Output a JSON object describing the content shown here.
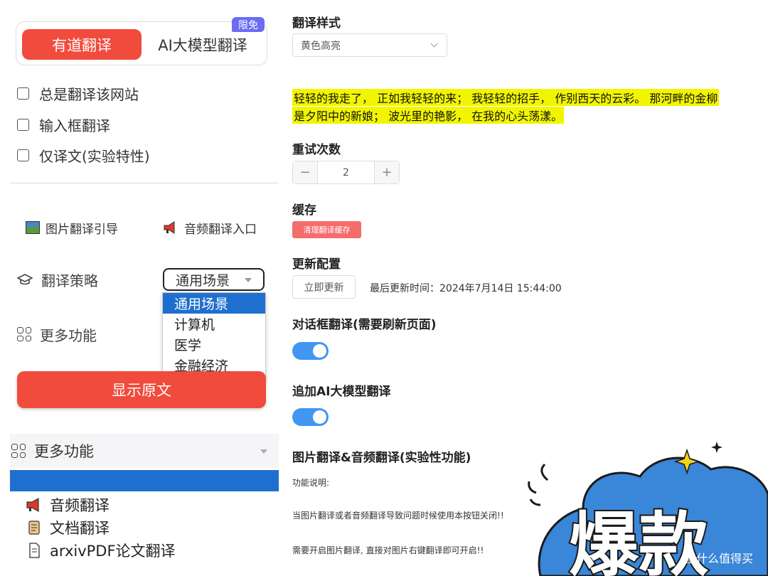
{
  "left": {
    "tabs": {
      "active": "有道翻译",
      "ai": "AI大模型翻译",
      "badge": "限免"
    },
    "checkboxes": [
      "总是翻译该网站",
      "输入框翻译",
      "仅译文(实验特性)"
    ],
    "links": {
      "image_guide": "图片翻译引导",
      "audio_entry": "音频翻译入口"
    },
    "strategy": {
      "label": "翻译策略",
      "selected": "通用场景",
      "options": [
        "通用场景",
        "计算机",
        "医学",
        "金融经济"
      ]
    },
    "more_features": "更多功能",
    "show_original": "显示原文",
    "more_bar": "更多功能",
    "list": [
      "音频翻译",
      "文档翻译",
      "arxivPDF论文翻译"
    ]
  },
  "right": {
    "style_title": "翻译样式",
    "style_selected": "黄色高亮",
    "sample_line1": "轻轻的我走了， 正如我轻轻的来； 我轻轻的招手， 作别西天的云彩。 那河畔的金柳",
    "sample_line2": "是夕阳中的新娘； 波光里的艳影， 在我的心头荡漾。",
    "retry_title": "重试次数",
    "retry_value": "2",
    "cache_title": "缓存",
    "clear_cache": "清理翻译缓存",
    "update_title": "更新配置",
    "update_now": "立即更新",
    "last_update": "最后更新时间：2024年7月14日 15:44:00",
    "dialog_title": "对话框翻译(需要刷新页面)",
    "ai_append_title": "追加AI大模型翻译",
    "img_audio_title": "图片翻译&音频翻译(实验性功能)",
    "desc_label": "功能说明:",
    "desc_line1": "当图片翻译或者音频翻译导致问题时候使用本按钮关闭!!",
    "desc_line2": "需要开启图片翻译, 直接对图片右键翻译即可开启!!"
  },
  "overlay": {
    "sticker": "爆款",
    "watermark": "值 什么值得买"
  }
}
